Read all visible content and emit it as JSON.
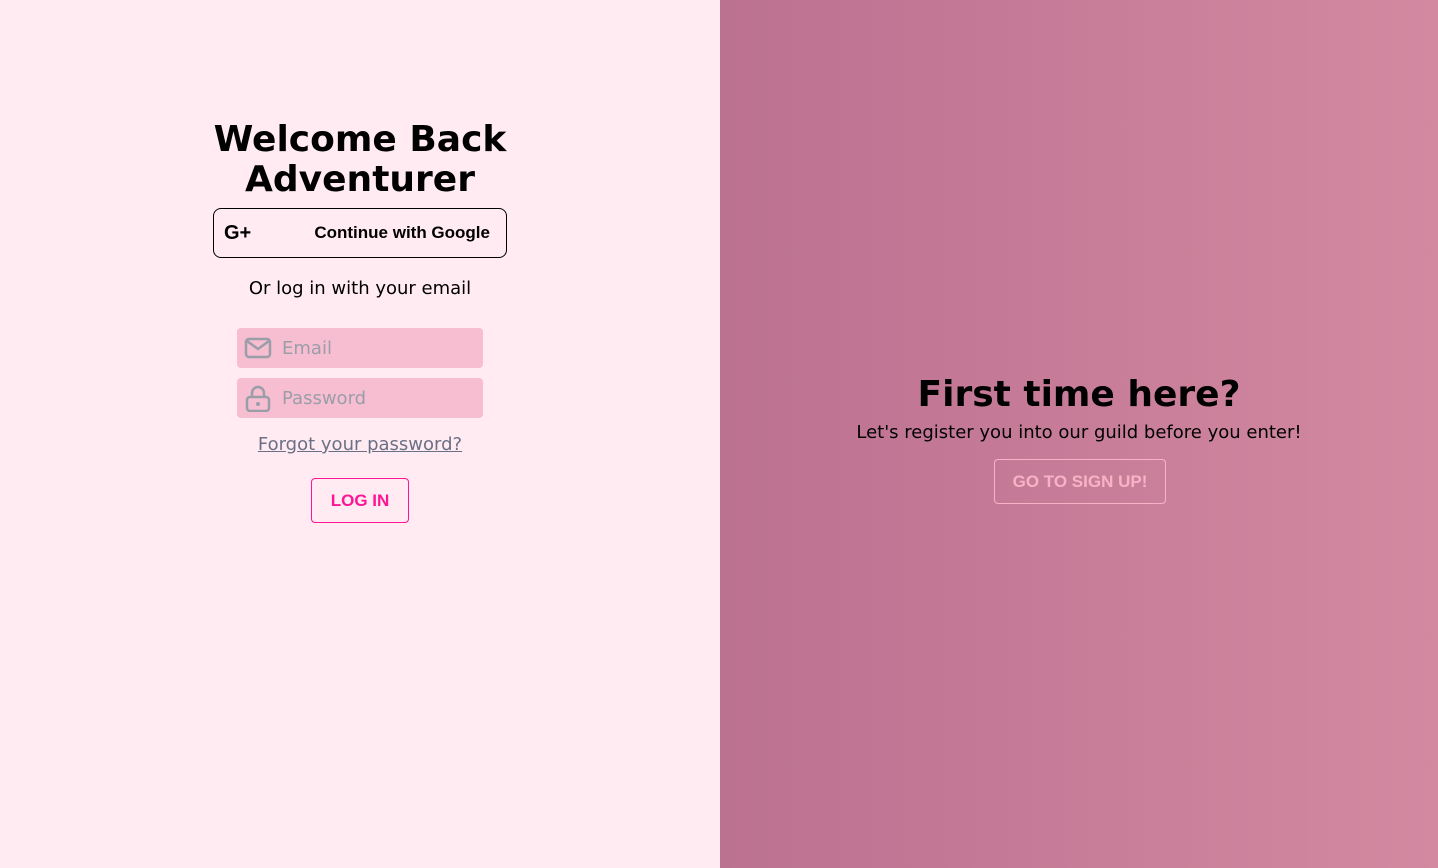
{
  "login": {
    "title_line1": "Welcome Back",
    "title_line2": "Adventurer",
    "google_icon": "G+",
    "google_label": "Continue with Google",
    "or_text": "Or log in with your email",
    "email_placeholder": "Email",
    "password_placeholder": "Password",
    "forgot_label": "Forgot your password?",
    "login_label": "LOG IN"
  },
  "signup": {
    "title": "First time here?",
    "subtitle": "Let's register you into our guild before you enter!",
    "button_label": "GO TO SIGN UP!"
  },
  "colors": {
    "accent": "#ff1493",
    "left_bg": "#ffebf1",
    "right_start": "#bb7190",
    "right_end": "#d389a0",
    "field_bg": "#f7bdd0"
  }
}
